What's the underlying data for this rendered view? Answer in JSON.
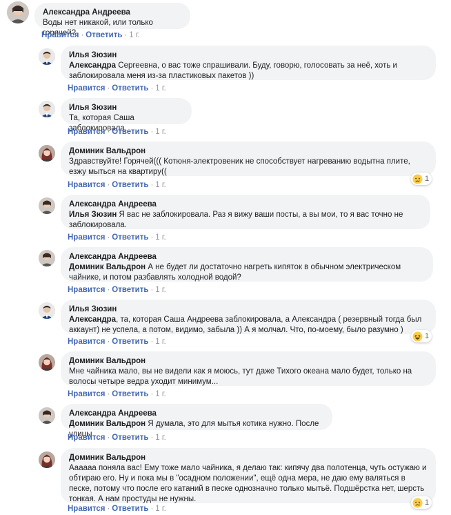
{
  "actions": {
    "like": "Нравится",
    "reply": "Ответить",
    "sep": "·",
    "time": "1 г."
  },
  "comments": [
    {
      "author": "Александра Андреева",
      "mention": "",
      "text": "Воды нет никакой, или только горячей?",
      "avatar": "alexandra-avatar"
    },
    {
      "author": "Илья Зюзин",
      "mention": "Александра",
      "text": " Сергеевна, о вас тоже спрашивали. Буду, говорю, голосовать за неё, хоть и заблокировала меня из-за пластиковых пакетов ))",
      "avatar": "ilya-avatar"
    },
    {
      "author": "Илья Зюзин",
      "mention": "",
      "text": "Та, которая Саша заблокировала.",
      "avatar": "ilya-avatar"
    },
    {
      "author": "Доминик Вальдрон",
      "mention": "",
      "text": "Здравствуйте! Горячей((( Котюня-электровеник не способствует нагреванию водытна плите, езжу мыться на квартиру((",
      "avatar": "dominik-avatar",
      "reaction": {
        "icon": "sad-emoji",
        "count": "1"
      }
    },
    {
      "author": "Александра Андреева",
      "mention": "Илья Зюзин",
      "text": " Я вас не заблокировала. Раз я вижу ваши посты, а вы мои, то я вас точно не заблокировала.",
      "avatar": "alexandra-avatar"
    },
    {
      "author": "Александра Андреева",
      "mention": "Доминик Вальдрон",
      "text": " А не будет ли достаточно нагреть кипяток в обычном электрическом чайнике, и потом разбавлять холодной водой?",
      "avatar": "alexandra-avatar"
    },
    {
      "author": "Илья Зюзин",
      "mention": "Александра",
      "text": ", та, которая Саша Андреева заблокировала, а Александра ( резервный тогда был аккаунт) не успела, а потом, видимо, забыла )) А я молчал. Что, по-моему, было разумно )",
      "avatar": "ilya-avatar",
      "reaction": {
        "icon": "laugh-emoji",
        "count": "1"
      }
    },
    {
      "author": "Доминик Вальдрон",
      "mention": "",
      "text": "Мне чайника мало, вы не видели как я моюсь, тут даже Тихого океана мало будет, только на волосы четыре ведра уходит минимум...",
      "avatar": "dominik-avatar"
    },
    {
      "author": "Александра Андреева",
      "mention": "Доминик Вальдрон",
      "text": " Я думала, это для мытья котика нужно. После улицы.",
      "avatar": "alexandra-avatar"
    },
    {
      "author": "Доминик Вальдрон",
      "mention": "",
      "text": "Аааааа поняла вас! Ему тоже мало чайника, я делаю так: кипячу два полотенца, чуть остужаю и обтираю его. Ну и пока мы в \"осадном положении\", ещё одна мера, не даю ему валяться в песке, потому что после его катаний в песке однозначно только мытьё. Подшёрстка нет, шерсть тонкая. А нам простуды не нужны.",
      "avatar": "dominik-avatar",
      "reaction": {
        "icon": "sad-emoji",
        "count": "1"
      }
    }
  ],
  "colors": {
    "link": "#4267b2",
    "bubble": "#f2f3f5",
    "meta": "#90949c"
  }
}
